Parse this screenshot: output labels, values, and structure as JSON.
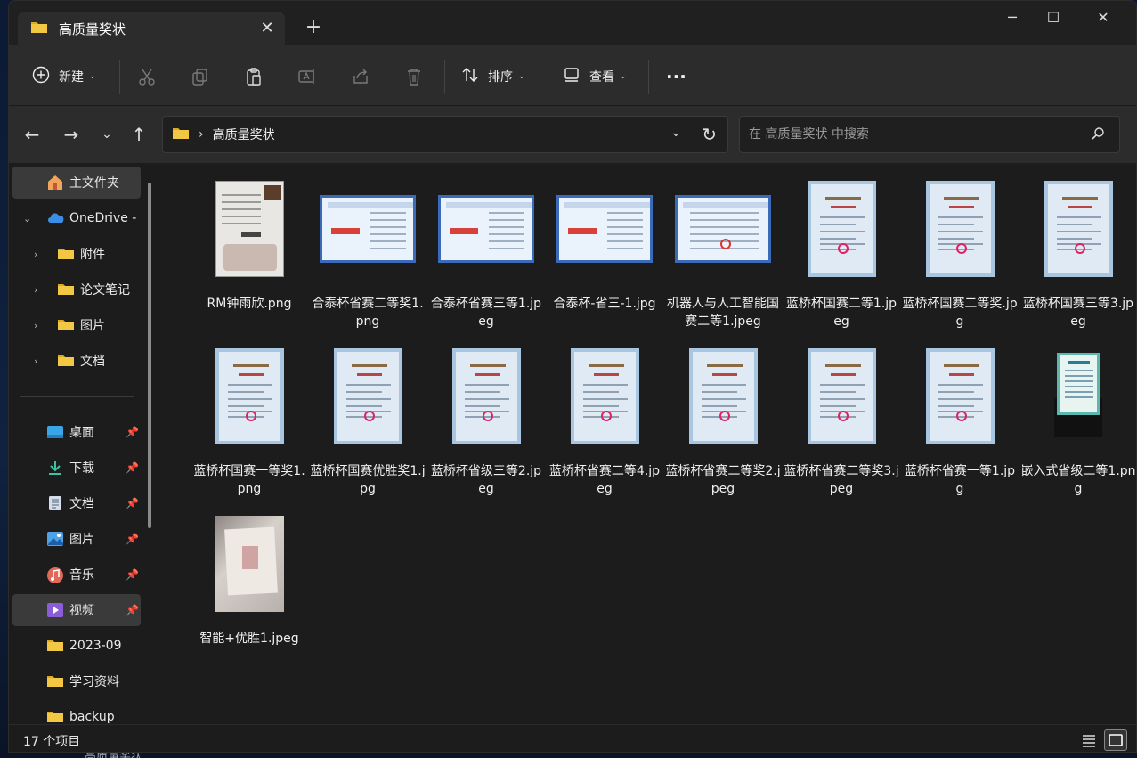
{
  "window": {
    "tab_title": "高质量奖状",
    "new_tab": "+",
    "close_tab": "✕"
  },
  "commandbar": {
    "new_label": "新建",
    "sort_label": "排序",
    "view_label": "查看",
    "more_label": "···"
  },
  "address": {
    "path": "高质量奖状",
    "separator": "›"
  },
  "search": {
    "placeholder": "在 高质量奖状 中搜索"
  },
  "sidebar": {
    "home": "主文件夹",
    "onedrive": "OneDrive -",
    "onedrive_children": [
      "附件",
      "论文笔记",
      "图片",
      "文档"
    ],
    "quick_access": [
      "桌面",
      "下载",
      "文档",
      "图片",
      "音乐",
      "视频"
    ],
    "folders": [
      "2023-09",
      "学习资料",
      "backup"
    ]
  },
  "files": [
    {
      "name": "RM钟雨欣.png",
      "thumb": "photo"
    },
    {
      "name": "合泰杯省赛二等奖1.png",
      "thumb": "horizontal"
    },
    {
      "name": "合泰杯省赛三等1.jpeg",
      "thumb": "horizontal"
    },
    {
      "name": "合泰杯-省三-1.jpg",
      "thumb": "horizontal"
    },
    {
      "name": "机器人与人工智能国赛二等1.jpeg",
      "thumb": "horizontal-red"
    },
    {
      "name": "蓝桥杯国赛二等1.jpeg",
      "thumb": "vertical"
    },
    {
      "name": "蓝桥杯国赛二等奖.jpg",
      "thumb": "vertical"
    },
    {
      "name": "蓝桥杯国赛三等3.jpeg",
      "thumb": "vertical"
    },
    {
      "name": "蓝桥杯国赛一等奖1.png",
      "thumb": "vertical"
    },
    {
      "name": "蓝桥杯国赛优胜奖1.jpg",
      "thumb": "vertical"
    },
    {
      "name": "蓝桥杯省级三等2.jpeg",
      "thumb": "vertical"
    },
    {
      "name": "蓝桥杯省赛二等4.jpeg",
      "thumb": "vertical"
    },
    {
      "name": "蓝桥杯省赛二等奖2.jpeg",
      "thumb": "vertical"
    },
    {
      "name": "蓝桥杯省赛二等奖3.jpeg",
      "thumb": "vertical"
    },
    {
      "name": "蓝桥杯省赛一等1.jpg",
      "thumb": "vertical"
    },
    {
      "name": "嵌入式省级二等1.png",
      "thumb": "teal"
    },
    {
      "name": "智能+优胜1.jpeg",
      "thumb": "photo2"
    }
  ],
  "status": {
    "count": "17 个项目"
  },
  "desktop": {
    "taskbar_text": "高质量奖状"
  },
  "colors": {
    "folder_yellow": "#f2c744",
    "background": "#1c1c1c",
    "toolbar": "#2c2c2c",
    "onedrive_blue": "#3a8ee6"
  }
}
